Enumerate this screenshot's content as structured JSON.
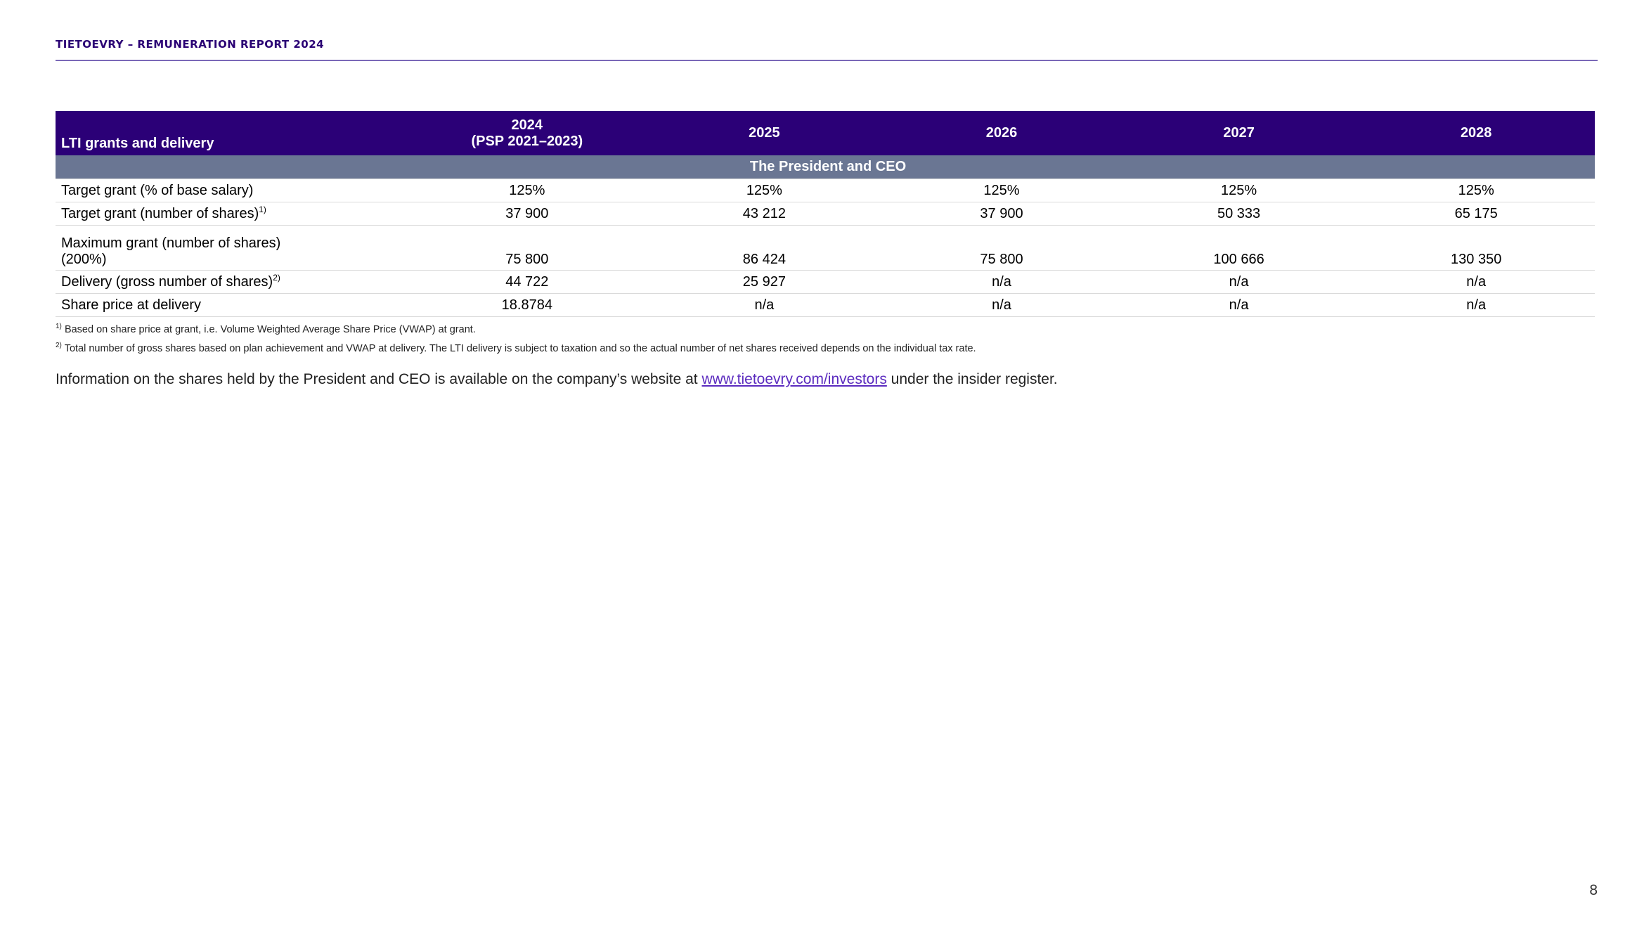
{
  "header": {
    "title": "TIETOEVRY – REMUNERATION REPORT 2024"
  },
  "table": {
    "header": {
      "first": "LTI grants and delivery",
      "col1_line1": "2024",
      "col1_line2": "(PSP 2021–2023)",
      "col2": "2025",
      "col3": "2026",
      "col4": "2027",
      "col5": "2028"
    },
    "section": "The President and CEO",
    "rows": [
      {
        "label": "Target grant (% of base salary)",
        "sup": "",
        "values": [
          "125%",
          "125%",
          "125%",
          "125%",
          "125%"
        ]
      },
      {
        "label": "Target grant (number of shares)",
        "sup": "1)",
        "values": [
          "37 900",
          "43 212",
          "37 900",
          "50 333",
          "65 175"
        ]
      },
      {
        "label_line1": "Maximum grant (number of shares)",
        "label_line2": "(200%)",
        "values": [
          "75 800",
          "86 424",
          "75 800",
          "100 666",
          "130 350"
        ]
      },
      {
        "label": "Delivery (gross number of shares)",
        "sup": "2)",
        "values": [
          "44 722",
          "25 927",
          "n/a",
          "n/a",
          "n/a"
        ]
      },
      {
        "label": "Share price at delivery",
        "sup": "",
        "values": [
          "18.8784",
          "n/a",
          "n/a",
          "n/a",
          "n/a"
        ]
      }
    ]
  },
  "footnotes": [
    {
      "mark": "1)",
      "text": "Based on share price at grant, i.e. Volume Weighted Average Share Price (VWAP) at grant."
    },
    {
      "mark": "2)",
      "text": "Total number of gross shares based on plan achievement and VWAP at delivery. The LTI delivery is subject to taxation and so the actual number of net shares received depends on the individual tax rate."
    }
  ],
  "info": {
    "before": "Information on the shares held by the President and CEO is available on the company’s website at ",
    "link": "www.tietoevry.com/investors",
    "after": " under the insider register."
  },
  "page_number": "8",
  "colors": {
    "header_text": "#2a0074",
    "table_header_bg": "#2b0077",
    "section_bg": "#6a7693",
    "link": "#5b2bbf"
  }
}
